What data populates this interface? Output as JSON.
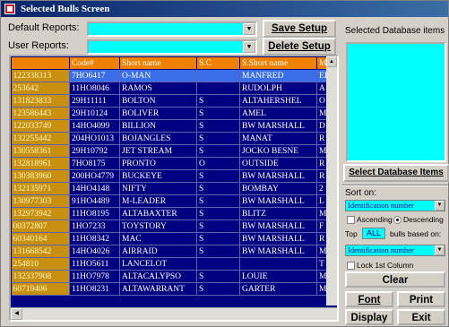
{
  "window": {
    "title": "Selected Bulls Screen"
  },
  "top": {
    "default_reports_label": "Default Reports:",
    "user_reports_label": "User Reports:",
    "save_setup": "Save Setup",
    "delete_setup": "Delete Setup"
  },
  "grid": {
    "columns": [
      "Code#",
      "Short name",
      "S.C",
      "S.Short name",
      "M"
    ],
    "rows": [
      [
        "122338313",
        "7HO6417",
        "O-MAN",
        "",
        "MANFRED",
        "EI"
      ],
      [
        "253642",
        "11HO8046",
        "RAMOS",
        "",
        "RUDOLPH",
        "A"
      ],
      [
        "131823833",
        "29H11111",
        "BOLTON",
        "S",
        "ALTAHERSHEL",
        "O"
      ],
      [
        "123586443",
        "29H10124",
        "BOLIVER",
        "S",
        "AMEL",
        "M"
      ],
      [
        "122033749",
        "14HO4099",
        "BILLION",
        "S",
        "BW MARSHALL",
        "D"
      ],
      [
        "132255442",
        "204HO1013",
        "BOJANGLES",
        "S",
        "MANAT",
        "R"
      ],
      [
        "130558361",
        "29H10792",
        "JET STREAM",
        "S",
        "JOCKO BESNE",
        "M"
      ],
      [
        "132818961",
        "7HO8175",
        "PRONTO",
        "O",
        "OUTSIDE",
        "R"
      ],
      [
        "130383960",
        "200HO4779",
        "BUCKEYE",
        "S",
        "BW MARSHALL",
        "R"
      ],
      [
        "132135971",
        "14HO4148",
        "NIFTY",
        "S",
        "BOMBAY",
        "2"
      ],
      [
        "130977303",
        "91HO4489",
        "M-LEADER",
        "S",
        "BW MARSHALL",
        "L"
      ],
      [
        "132973942",
        "11HO8195",
        "ALTABAXTER",
        "S",
        "BLITZ",
        "M"
      ],
      [
        "00372807",
        "1HO7233",
        "TOYSTORY",
        "S",
        "BW MARSHALL",
        "F"
      ],
      [
        "60340164",
        "11HO8342",
        "MAC",
        "S",
        "BW MARSHALL",
        "R"
      ],
      [
        "131668542",
        "14HO4026",
        "AIRRAID",
        "S",
        "BW MARSHALL",
        "M"
      ],
      [
        "254810",
        "11HO5611",
        "LANCELOT",
        "",
        "",
        "T"
      ],
      [
        "132337908",
        "11HO7978",
        "ALTACALYPSO",
        "S",
        "LOUIE",
        "M"
      ],
      [
        "60719406",
        "11HO8231",
        "ALTAWARRANT",
        "S",
        "GARTER",
        "M"
      ]
    ]
  },
  "side": {
    "selected_db_label": "Selected Database items",
    "select_db_button": "Select Database Items",
    "sort_on_label": "Sort on:",
    "sort_field": "Identification number",
    "ascending": "Ascending",
    "descending": "Descending",
    "sort_order": "Descending",
    "top_label": "Top",
    "top_value": "ALL",
    "bulls_based_on": "bulls based on:",
    "based_on_field": "Identification number",
    "lock_first_col": "Lock 1st Column",
    "clear": "Clear",
    "font": "Font",
    "print": "Print",
    "display": "Display",
    "exit": "Exit"
  }
}
